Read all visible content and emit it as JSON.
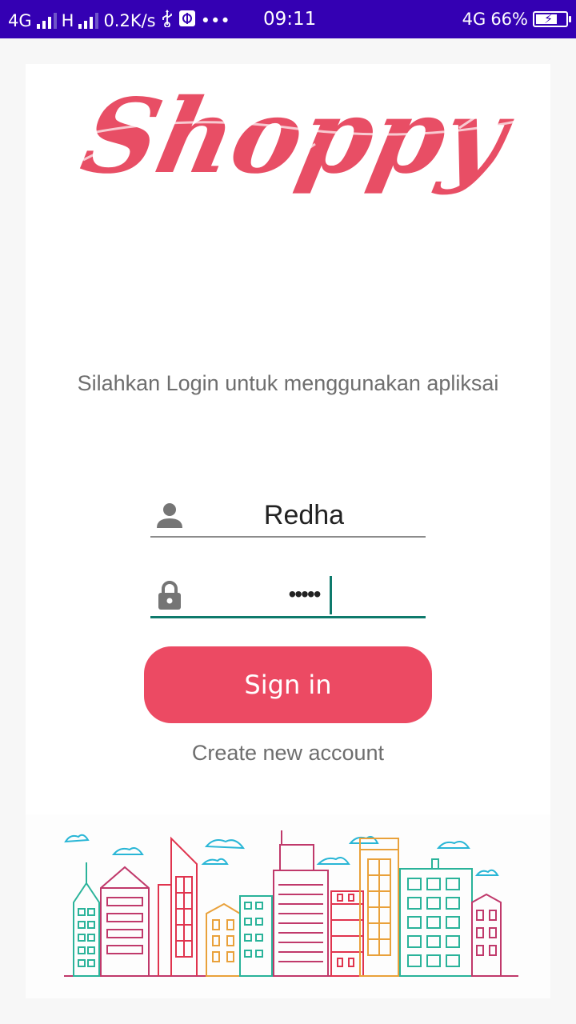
{
  "status_bar": {
    "network1": "4G",
    "network2": "H",
    "speed": "0.2K/s",
    "more": "•••",
    "time": "09:11",
    "network_right": "4G",
    "battery": "66%"
  },
  "app": {
    "logo_text": "Shoppy",
    "subtitle": "Silahkan Login untuk menggunakan apliksai",
    "username_value": "Redha",
    "password_value": "•••••",
    "signin_label": "Sign in",
    "create_account_label": "Create new account"
  },
  "colors": {
    "status_bar": "#3400b3",
    "brand": "#ec4a63",
    "accent": "#0e7a6c"
  },
  "icons": [
    "usb-icon",
    "usb-debug-icon",
    "person-icon",
    "lock-icon",
    "battery-icon"
  ]
}
